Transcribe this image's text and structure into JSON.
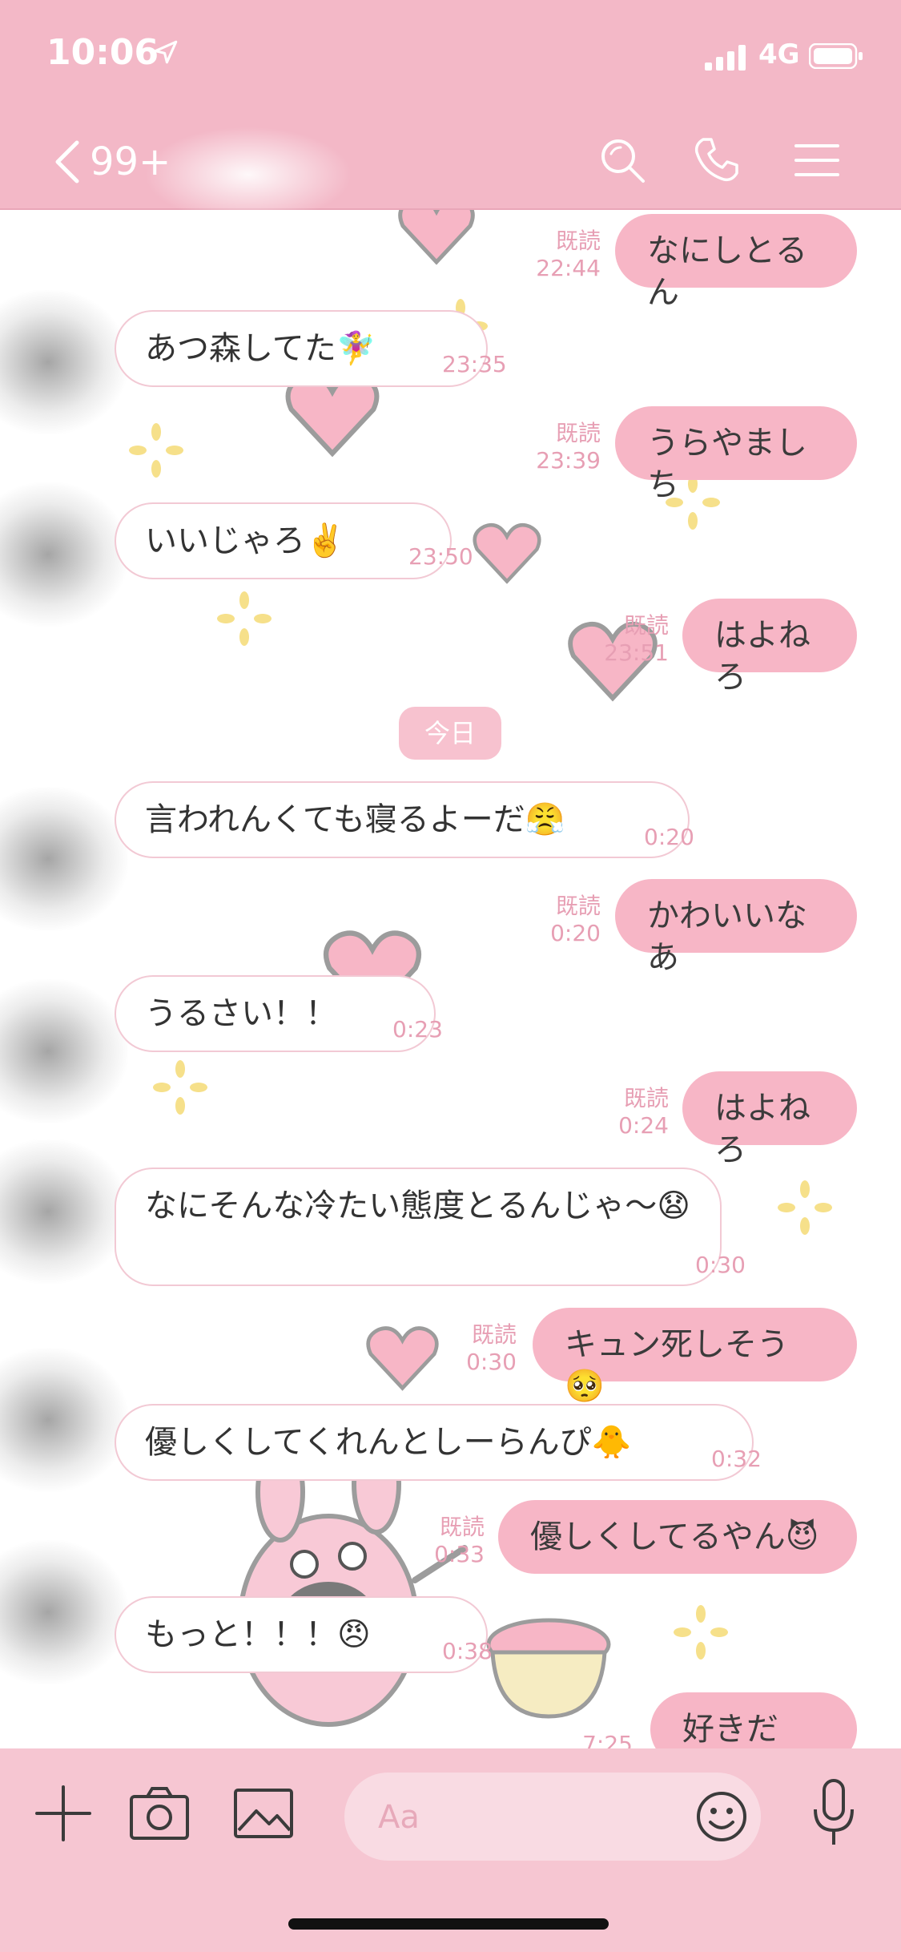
{
  "status_bar": {
    "time": "10:06",
    "network": "4G"
  },
  "header": {
    "back_count": "99+"
  },
  "chat": {
    "messages": [
      {
        "dir": "out",
        "text": "なにしとるん",
        "read": "既読",
        "time": "22:44"
      },
      {
        "dir": "in",
        "text": "あつ森してた🧚‍♀️",
        "time": "23:35"
      },
      {
        "dir": "out",
        "text": "うらやましち",
        "read": "既読",
        "time": "23:39"
      },
      {
        "dir": "in",
        "text": "いいじゃろ✌️",
        "time": "23:50"
      },
      {
        "dir": "out",
        "text": "はよねろ",
        "read": "既読",
        "time": "23:51"
      },
      {
        "dir": "in",
        "text": "言われんくても寝るよーだ😤",
        "time": "0:20"
      },
      {
        "dir": "out",
        "text": "かわいいなあ",
        "read": "既読",
        "time": "0:20"
      },
      {
        "dir": "in",
        "text": "うるさい！！",
        "time": "0:23"
      },
      {
        "dir": "out",
        "text": "はよねろ",
        "read": "既読",
        "time": "0:24"
      },
      {
        "dir": "in",
        "text": "なにそんな冷たい態度とるんじゃ〜😧",
        "time": "0:30"
      },
      {
        "dir": "out",
        "text": "キュン死しそう🥺",
        "read": "既読",
        "time": "0:30"
      },
      {
        "dir": "in",
        "text": "優しくしてくれんとしーらんぴ🐥",
        "time": "0:32"
      },
      {
        "dir": "out",
        "text": "優しくしてるやん😈",
        "read": "既読",
        "time": "0:33"
      },
      {
        "dir": "in",
        "text": "もっと！！！😠",
        "time": "0:38"
      },
      {
        "dir": "out",
        "text": "好きだー！",
        "time": "7:25"
      }
    ],
    "date_separator": "今日"
  },
  "composer": {
    "placeholder": "Aa"
  },
  "icons": [
    "location-arrow-icon",
    "signal-icon",
    "battery-icon",
    "back-chevron-icon",
    "search-icon",
    "phone-icon",
    "menu-icon",
    "plus-icon",
    "camera-icon",
    "image-icon",
    "emoji-icon",
    "microphone-icon"
  ]
}
